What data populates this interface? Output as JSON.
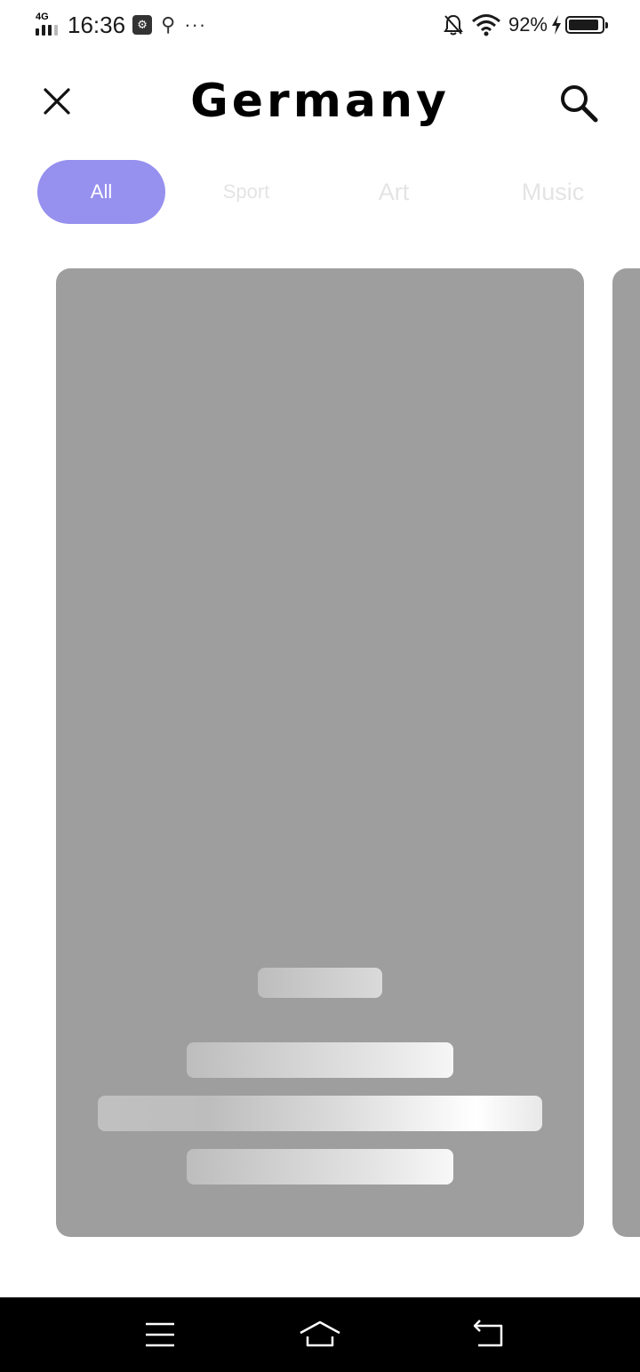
{
  "status_bar": {
    "network": "4G",
    "time": "16:36",
    "battery_percent": "92%",
    "battery_level": 0.92,
    "icons": [
      "signal-icon",
      "usb-debug-icon",
      "usb-icon",
      "more-icon",
      "mute-bell-icon",
      "wifi-icon",
      "charging-icon",
      "battery-icon"
    ]
  },
  "header": {
    "title": "Germany",
    "close_icon": "close-icon",
    "search_icon": "search-icon"
  },
  "tabs": [
    {
      "label": "All",
      "active": true
    },
    {
      "label": "Sport",
      "active": false
    },
    {
      "label": "Art",
      "active": false
    },
    {
      "label": "Music",
      "active": false
    }
  ],
  "colors": {
    "accent": "#9690ef",
    "card_placeholder": "#9e9e9e",
    "inactive_tab_text": "#e4e4e4",
    "nav_bar": "#000000"
  },
  "nav_bar": {
    "icons": [
      "menu-icon",
      "home-icon",
      "back-icon"
    ]
  }
}
